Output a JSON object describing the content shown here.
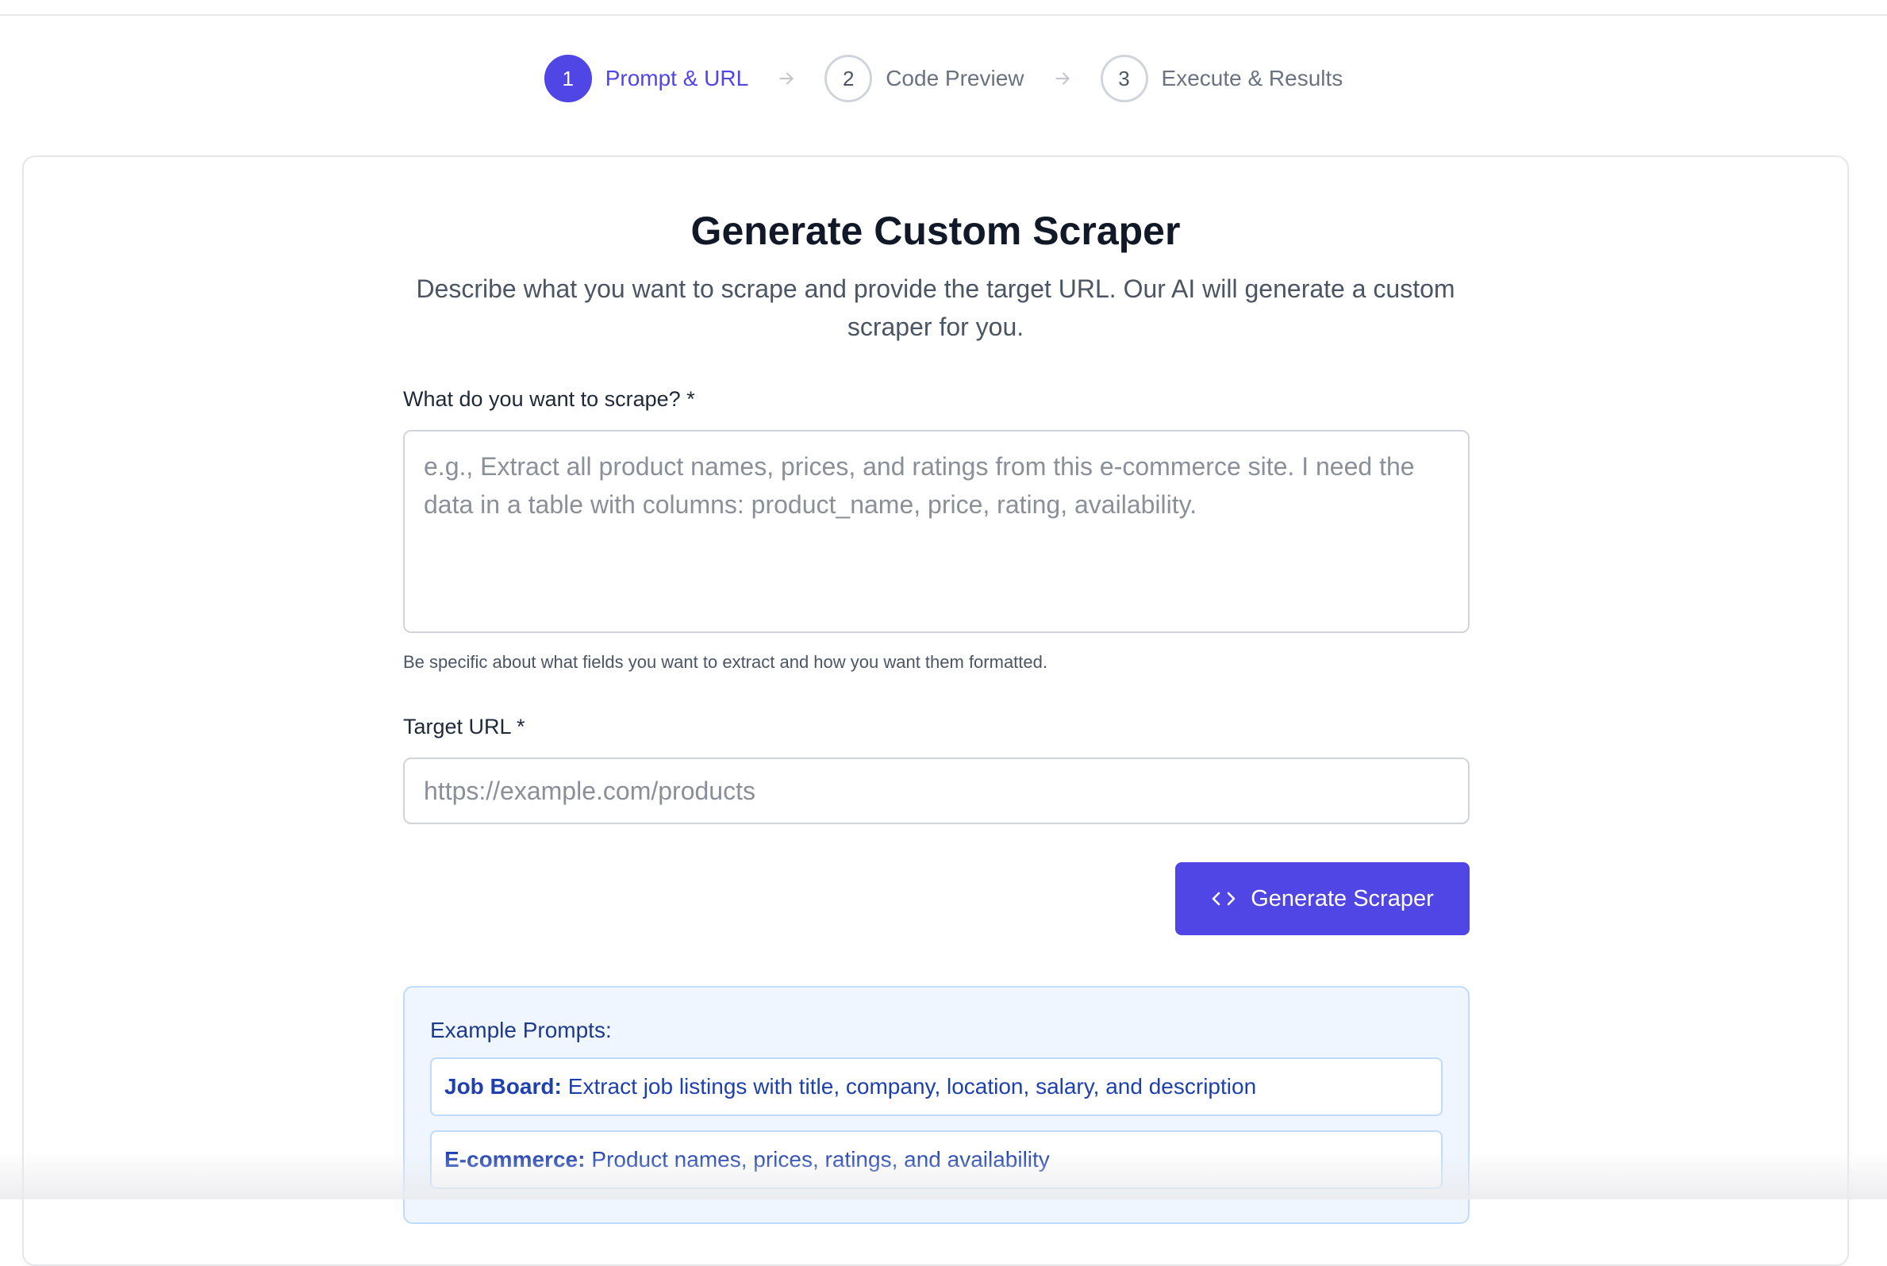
{
  "stepper": {
    "steps": [
      {
        "number": "1",
        "label": "Prompt & URL",
        "state": "active"
      },
      {
        "number": "2",
        "label": "Code Preview",
        "state": "inactive"
      },
      {
        "number": "3",
        "label": "Execute & Results",
        "state": "inactive"
      }
    ],
    "arrow_icon": "arrow-right-icon"
  },
  "main": {
    "title": "Generate Custom Scraper",
    "subtitle": "Describe what you want to scrape and provide the target URL. Our AI will generate a custom scraper for you."
  },
  "form": {
    "prompt_label": "What do you want to scrape? *",
    "prompt_value": "",
    "prompt_placeholder": "e.g., Extract all product names, prices, and ratings from this e-commerce site. I need the data in a table with columns: product_name, price, rating, availability.",
    "prompt_help": "Be specific about what fields you want to extract and how you want them formatted.",
    "url_label": "Target URL *",
    "url_value": "",
    "url_placeholder": "https://example.com/products",
    "generate_button": {
      "label": "Generate Scraper",
      "icon": "code-icon"
    }
  },
  "examples": {
    "title": "Example Prompts:",
    "items": [
      {
        "category": "Job Board:",
        "text": "Extract job listings with title, company, location, salary, and description"
      },
      {
        "category": "E-commerce:",
        "text": "Product names, prices, ratings, and availability"
      }
    ]
  },
  "colors": {
    "accent": "#4f46e5",
    "examples_bg": "#eff6ff",
    "examples_border": "#bfdbfe",
    "examples_text": "#1e40af"
  }
}
